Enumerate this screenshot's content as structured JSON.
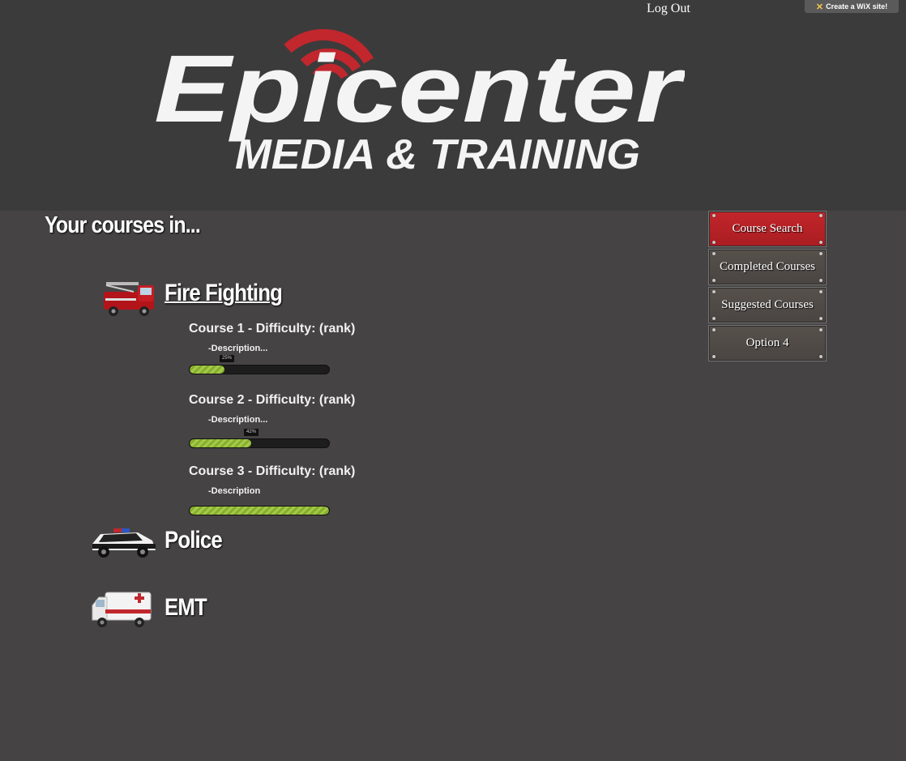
{
  "header": {
    "logout_label": "Log Out",
    "wix_badge": "Create a WiX site!",
    "logo": {
      "line1": "Epicenter",
      "line2": "MEDIA & TRAINING",
      "accent_color": "#c1272d"
    }
  },
  "page_heading": "Your courses in...",
  "categories": [
    {
      "title": "Fire Fighting",
      "icon": "fire-truck-icon",
      "courses": [
        {
          "title": "Course 1 - Difficulty: (rank)",
          "description": "-Description...",
          "progress": 0.25,
          "tooltip": "25%"
        },
        {
          "title": "Course 2 - Difficulty: (rank)",
          "description": "-Description...",
          "progress": 0.44,
          "tooltip": "42%"
        },
        {
          "title": "Course 3 - Difficulty: (rank)",
          "description": "-Description",
          "progress": 1.0,
          "tooltip": ""
        }
      ]
    },
    {
      "title": "Police",
      "icon": "police-car-icon"
    },
    {
      "title": "EMT",
      "icon": "ambulance-icon"
    }
  ],
  "menu": {
    "items": [
      {
        "label": "Course Search",
        "active": true
      },
      {
        "label": "Completed Courses",
        "active": false
      },
      {
        "label": "Suggested Courses",
        "active": false
      },
      {
        "label": "Option 4",
        "active": false
      }
    ],
    "active_color": "#c1272d"
  }
}
